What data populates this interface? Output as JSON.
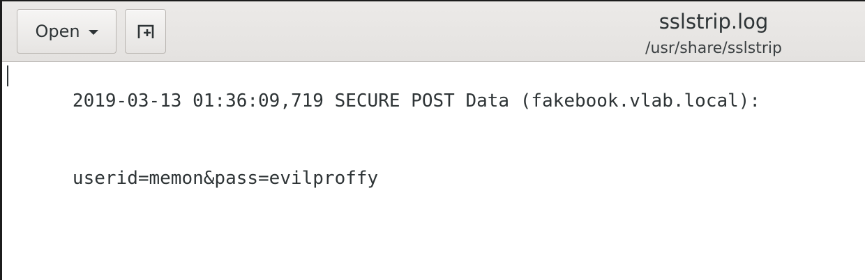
{
  "header": {
    "open_label": "Open",
    "open_icon": "chevron-down-icon",
    "new_tab_icon": "new-tab-icon",
    "title": "sslstrip.log",
    "subtitle": "/usr/share/sslstrip"
  },
  "editor": {
    "lines": [
      "2019-03-13 01:36:09,719 SECURE POST Data (fakebook.vlab.local):",
      "userid=memon&pass=evilproffy"
    ]
  }
}
